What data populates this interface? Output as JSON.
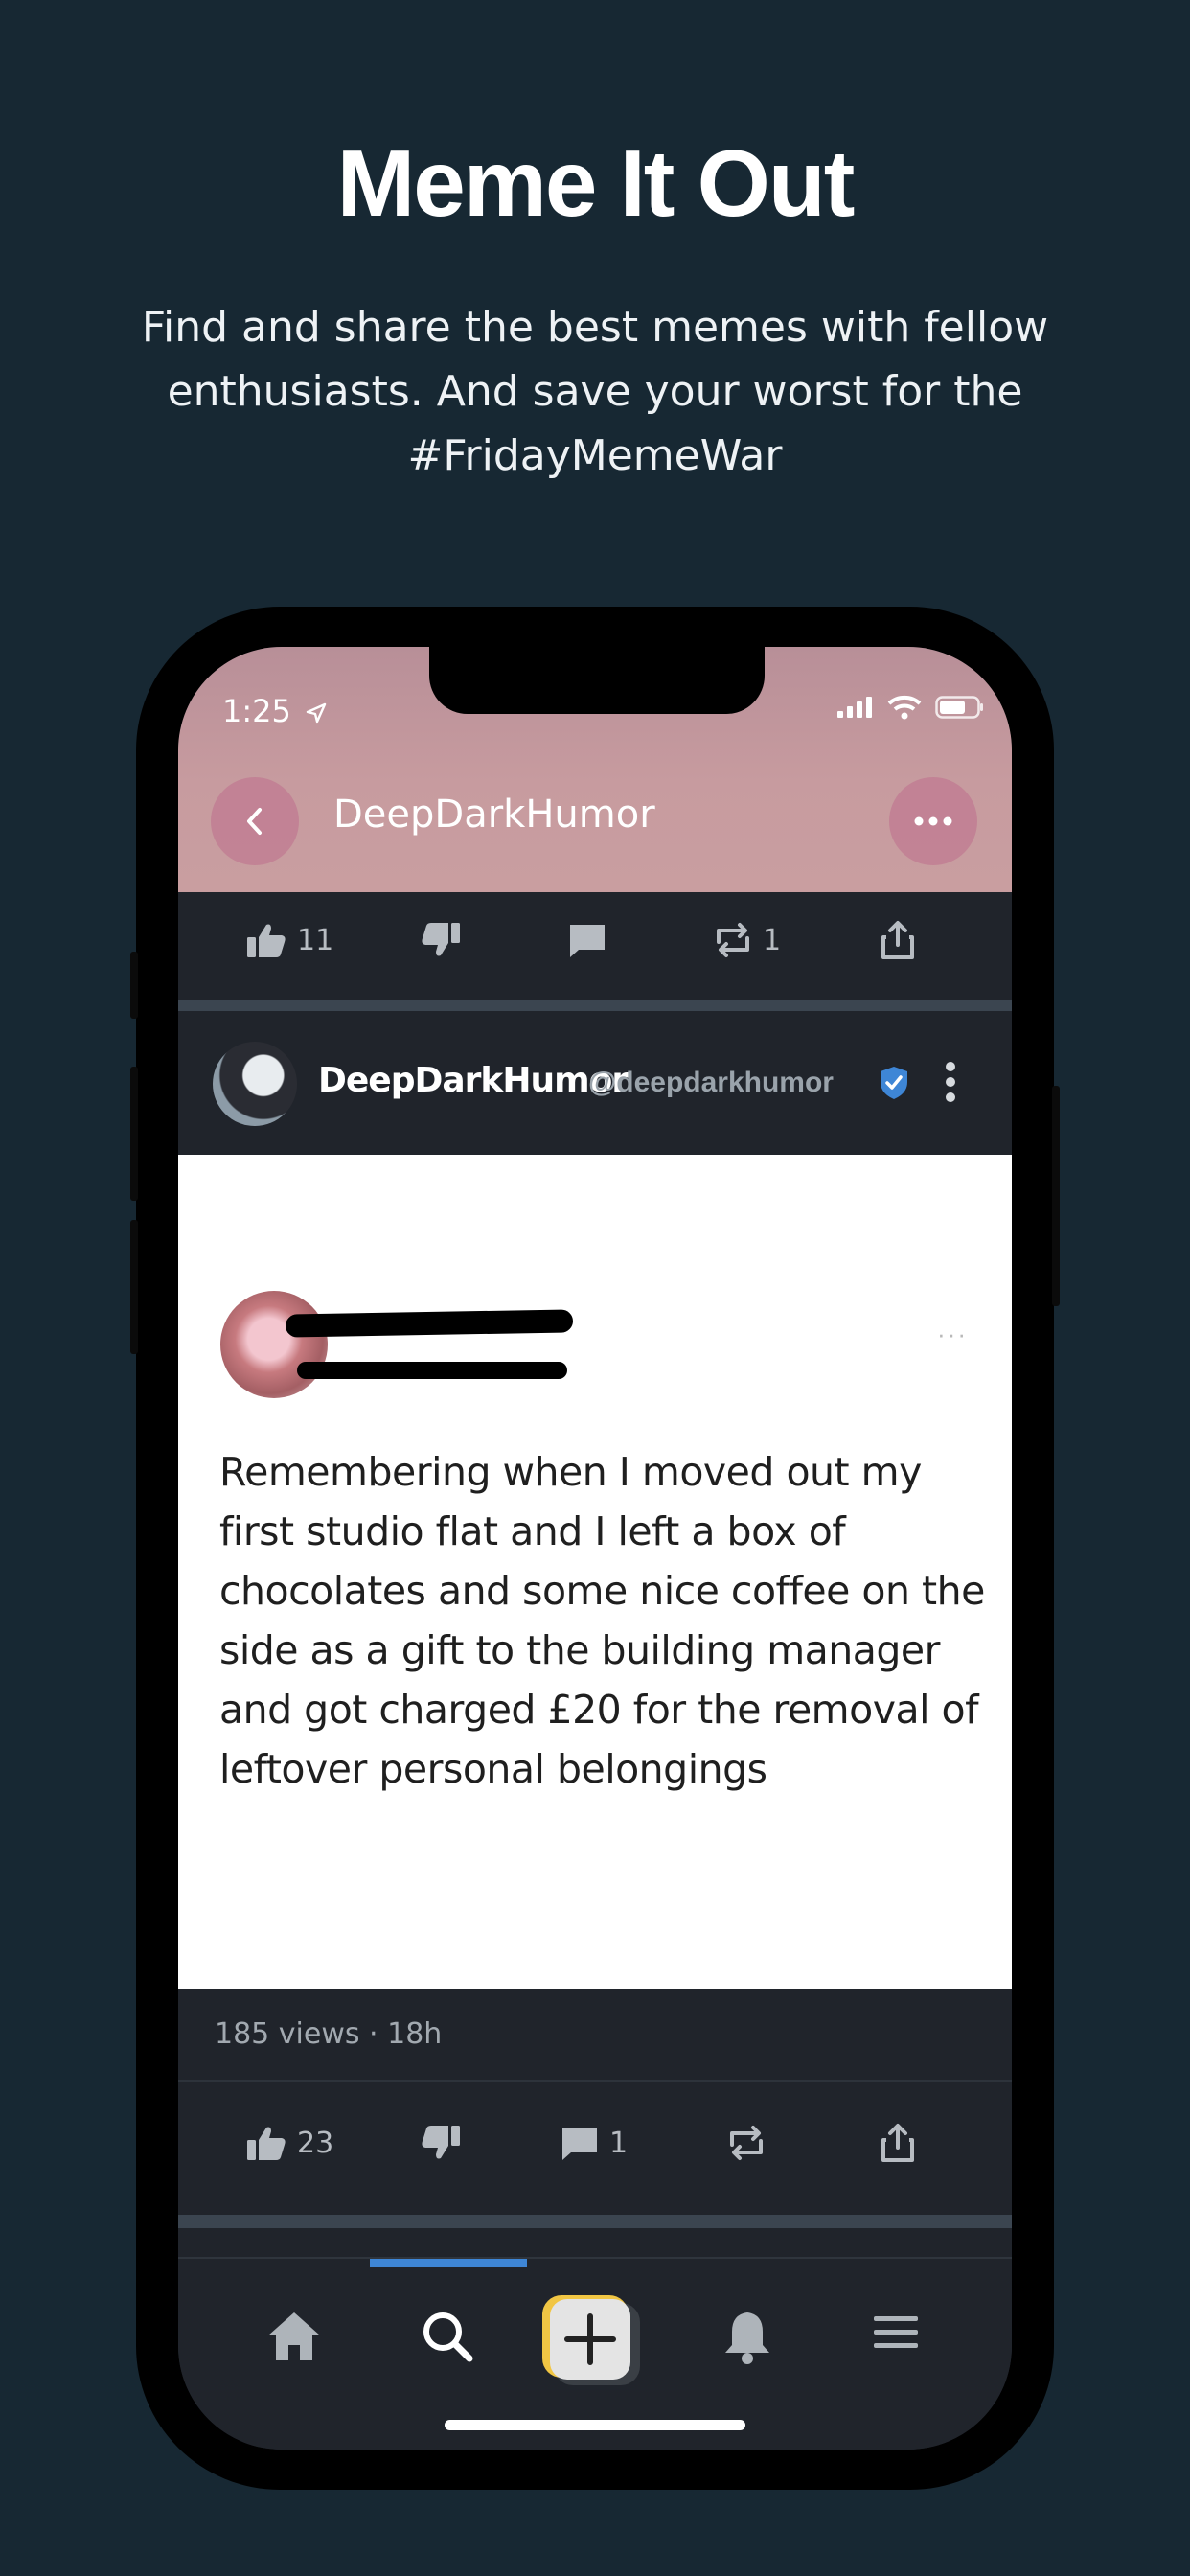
{
  "promo": {
    "headline": "Meme It Out",
    "subline": "Find and share the best memes with fellow enthusiasts. And save your worst for the #FridayMemeWar"
  },
  "status_bar": {
    "time": "1:25"
  },
  "nav": {
    "title": "DeepDarkHumor"
  },
  "top_actions": {
    "likes": "11",
    "reposts": "1"
  },
  "post": {
    "author": "DeepDarkHumor",
    "handle": "@deepdarkhumor",
    "meme_text": "Remembering when I moved out my first studio flat and I left a box of chocolates and some nice coffee on the side as a gift to the building manager and got charged £20 for the removal of leftover personal belongings",
    "meta": "185 views · 18h",
    "likes": "23",
    "comments": "1"
  },
  "colors": {
    "background": "#172833",
    "accent": "#3e86d6",
    "header": "#c79b9f"
  },
  "icons": [
    "back-chevron-icon",
    "more-dots-icon",
    "thumbs-up-icon",
    "thumbs-down-icon",
    "comment-icon",
    "repost-icon",
    "share-icon",
    "verified-badge-icon",
    "kebab-icon",
    "home-icon",
    "search-icon",
    "create-icon",
    "bell-icon",
    "menu-icon"
  ]
}
